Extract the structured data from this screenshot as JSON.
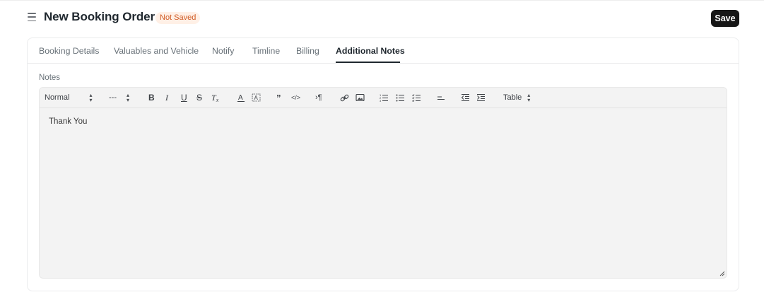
{
  "header": {
    "title": "New Booking Order",
    "status": "Not Saved",
    "save_label": "Save"
  },
  "tabs": [
    {
      "label": "Booking Details",
      "active": false
    },
    {
      "label": "Valuables and Vehicle",
      "active": false
    },
    {
      "label": "Notify",
      "active": false
    },
    {
      "label": "Timline",
      "active": false
    },
    {
      "label": "Billing",
      "active": false
    },
    {
      "label": "Additional Notes",
      "active": true
    }
  ],
  "notes": {
    "label": "Notes",
    "content": "Thank You"
  },
  "toolbar": {
    "format_value": "Normal",
    "size_value": "---",
    "table_label": "Table"
  },
  "colors": {
    "accent": "#171717",
    "status_text": "#d05a24",
    "status_bg": "#fff0e6",
    "editor_bg": "#f3f3f3"
  }
}
